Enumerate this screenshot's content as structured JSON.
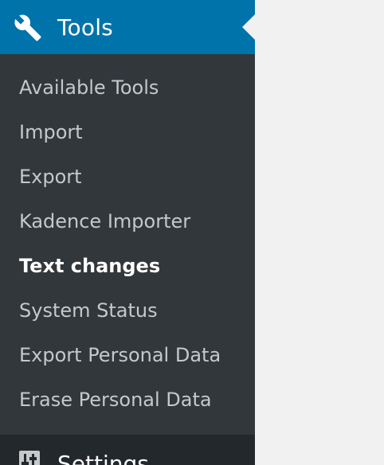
{
  "colors": {
    "sidebar_bg": "#32373c",
    "active_header_bg": "#0073aa",
    "content_bg": "#f1f1f1",
    "submenu_text": "#c6c8c9",
    "current_text": "#ffffff",
    "next_menu_bg": "#23282d"
  },
  "sidebar": {
    "active_menu": {
      "label": "Tools",
      "icon": "wrench-icon"
    },
    "submenu": [
      {
        "label": "Available Tools",
        "current": false
      },
      {
        "label": "Import",
        "current": false
      },
      {
        "label": "Export",
        "current": false
      },
      {
        "label": "Kadence Importer",
        "current": false
      },
      {
        "label": "Text changes",
        "current": true
      },
      {
        "label": "System Status",
        "current": false
      },
      {
        "label": "Export Personal Data",
        "current": false
      },
      {
        "label": "Erase Personal Data",
        "current": false
      }
    ],
    "next_menu": {
      "label": "Settings",
      "icon": "settings-sliders-icon"
    }
  }
}
